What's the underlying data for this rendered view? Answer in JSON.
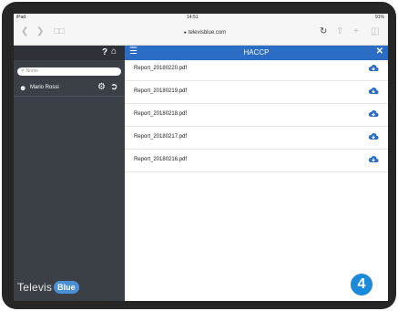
{
  "status_bar": {
    "left": "iPad",
    "time": "14:51",
    "right": "91%"
  },
  "browser": {
    "back_icon": "chevron-left-icon",
    "forward_icon": "chevron-right-icon",
    "bookmarks_icon": "book-icon",
    "url": "televisblue.com",
    "reload_icon": "reload-icon",
    "share_icon": "share-icon",
    "add_icon": "plus-icon",
    "tabs_icon": "tabs-icon"
  },
  "sidebar": {
    "help_label": "?",
    "home_icon": "home-icon",
    "search_placeholder": "Nome",
    "user_name": "Mario Rossi",
    "settings_icon": "gear-icon",
    "logout_icon": "logout-icon",
    "logo_text": "Televis",
    "logo_pill": "Blue"
  },
  "main": {
    "title": "HACCP",
    "files": [
      {
        "name": "Report_20180220.pdf"
      },
      {
        "name": "Report_20180219.pdf"
      },
      {
        "name": "Report_20180218.pdf"
      },
      {
        "name": "Report_20180217.pdf"
      },
      {
        "name": "Report_20180216.pdf"
      }
    ]
  },
  "step_badge": "4",
  "colors": {
    "accent": "#2b6cc4",
    "sidebar_bg": "#3b4047",
    "badge": "#1c8ad8"
  }
}
